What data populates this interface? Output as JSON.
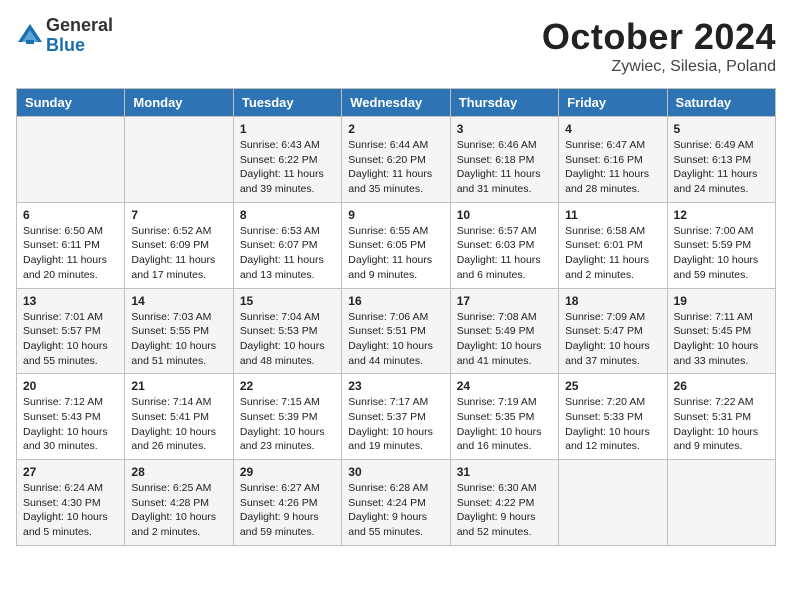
{
  "header": {
    "logo_general": "General",
    "logo_blue": "Blue",
    "title": "October 2024",
    "subtitle": "Zywiec, Silesia, Poland"
  },
  "weekdays": [
    "Sunday",
    "Monday",
    "Tuesday",
    "Wednesday",
    "Thursday",
    "Friday",
    "Saturday"
  ],
  "weeks": [
    [
      {
        "day": "",
        "content": ""
      },
      {
        "day": "",
        "content": ""
      },
      {
        "day": "1",
        "content": "Sunrise: 6:43 AM\nSunset: 6:22 PM\nDaylight: 11 hours and 39 minutes."
      },
      {
        "day": "2",
        "content": "Sunrise: 6:44 AM\nSunset: 6:20 PM\nDaylight: 11 hours and 35 minutes."
      },
      {
        "day": "3",
        "content": "Sunrise: 6:46 AM\nSunset: 6:18 PM\nDaylight: 11 hours and 31 minutes."
      },
      {
        "day": "4",
        "content": "Sunrise: 6:47 AM\nSunset: 6:16 PM\nDaylight: 11 hours and 28 minutes."
      },
      {
        "day": "5",
        "content": "Sunrise: 6:49 AM\nSunset: 6:13 PM\nDaylight: 11 hours and 24 minutes."
      }
    ],
    [
      {
        "day": "6",
        "content": "Sunrise: 6:50 AM\nSunset: 6:11 PM\nDaylight: 11 hours and 20 minutes."
      },
      {
        "day": "7",
        "content": "Sunrise: 6:52 AM\nSunset: 6:09 PM\nDaylight: 11 hours and 17 minutes."
      },
      {
        "day": "8",
        "content": "Sunrise: 6:53 AM\nSunset: 6:07 PM\nDaylight: 11 hours and 13 minutes."
      },
      {
        "day": "9",
        "content": "Sunrise: 6:55 AM\nSunset: 6:05 PM\nDaylight: 11 hours and 9 minutes."
      },
      {
        "day": "10",
        "content": "Sunrise: 6:57 AM\nSunset: 6:03 PM\nDaylight: 11 hours and 6 minutes."
      },
      {
        "day": "11",
        "content": "Sunrise: 6:58 AM\nSunset: 6:01 PM\nDaylight: 11 hours and 2 minutes."
      },
      {
        "day": "12",
        "content": "Sunrise: 7:00 AM\nSunset: 5:59 PM\nDaylight: 10 hours and 59 minutes."
      }
    ],
    [
      {
        "day": "13",
        "content": "Sunrise: 7:01 AM\nSunset: 5:57 PM\nDaylight: 10 hours and 55 minutes."
      },
      {
        "day": "14",
        "content": "Sunrise: 7:03 AM\nSunset: 5:55 PM\nDaylight: 10 hours and 51 minutes."
      },
      {
        "day": "15",
        "content": "Sunrise: 7:04 AM\nSunset: 5:53 PM\nDaylight: 10 hours and 48 minutes."
      },
      {
        "day": "16",
        "content": "Sunrise: 7:06 AM\nSunset: 5:51 PM\nDaylight: 10 hours and 44 minutes."
      },
      {
        "day": "17",
        "content": "Sunrise: 7:08 AM\nSunset: 5:49 PM\nDaylight: 10 hours and 41 minutes."
      },
      {
        "day": "18",
        "content": "Sunrise: 7:09 AM\nSunset: 5:47 PM\nDaylight: 10 hours and 37 minutes."
      },
      {
        "day": "19",
        "content": "Sunrise: 7:11 AM\nSunset: 5:45 PM\nDaylight: 10 hours and 33 minutes."
      }
    ],
    [
      {
        "day": "20",
        "content": "Sunrise: 7:12 AM\nSunset: 5:43 PM\nDaylight: 10 hours and 30 minutes."
      },
      {
        "day": "21",
        "content": "Sunrise: 7:14 AM\nSunset: 5:41 PM\nDaylight: 10 hours and 26 minutes."
      },
      {
        "day": "22",
        "content": "Sunrise: 7:15 AM\nSunset: 5:39 PM\nDaylight: 10 hours and 23 minutes."
      },
      {
        "day": "23",
        "content": "Sunrise: 7:17 AM\nSunset: 5:37 PM\nDaylight: 10 hours and 19 minutes."
      },
      {
        "day": "24",
        "content": "Sunrise: 7:19 AM\nSunset: 5:35 PM\nDaylight: 10 hours and 16 minutes."
      },
      {
        "day": "25",
        "content": "Sunrise: 7:20 AM\nSunset: 5:33 PM\nDaylight: 10 hours and 12 minutes."
      },
      {
        "day": "26",
        "content": "Sunrise: 7:22 AM\nSunset: 5:31 PM\nDaylight: 10 hours and 9 minutes."
      }
    ],
    [
      {
        "day": "27",
        "content": "Sunrise: 6:24 AM\nSunset: 4:30 PM\nDaylight: 10 hours and 5 minutes."
      },
      {
        "day": "28",
        "content": "Sunrise: 6:25 AM\nSunset: 4:28 PM\nDaylight: 10 hours and 2 minutes."
      },
      {
        "day": "29",
        "content": "Sunrise: 6:27 AM\nSunset: 4:26 PM\nDaylight: 9 hours and 59 minutes."
      },
      {
        "day": "30",
        "content": "Sunrise: 6:28 AM\nSunset: 4:24 PM\nDaylight: 9 hours and 55 minutes."
      },
      {
        "day": "31",
        "content": "Sunrise: 6:30 AM\nSunset: 4:22 PM\nDaylight: 9 hours and 52 minutes."
      },
      {
        "day": "",
        "content": ""
      },
      {
        "day": "",
        "content": ""
      }
    ]
  ]
}
